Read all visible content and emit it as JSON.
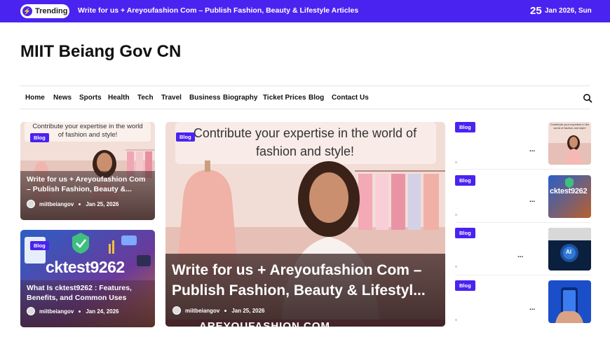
{
  "topbar": {
    "trending_label": "Trending",
    "trending_text": "Write for us + Areyoufashion Com – Publish Fashion, Beauty & Lifestyle Articles",
    "date_day": "25",
    "date_rest": "Jan 2026, Sun",
    "accent": "#4a23f0"
  },
  "site": {
    "title": "MIIT Beiang Gov CN"
  },
  "nav": {
    "items": [
      "Home",
      "News",
      "Sports",
      "Health",
      "Tech",
      "Travel",
      "Business",
      "Biography",
      "Ticket Prices",
      "Blog",
      "Contact Us"
    ]
  },
  "cards": {
    "left1": {
      "banner": "Contribute your expertise in the world of fashion and style!",
      "badge": "Blog",
      "title": "Write for us + Areyoufashion Com – Publish Fashion, Beauty &...",
      "author": "miitbeiangov",
      "date": "Jan 25, 2026"
    },
    "left2": {
      "badge": "Blog",
      "image_text": "cktest9262",
      "title": "What Is cktest9262 : Features, Benefits, and Common Uses",
      "author": "miitbeiangov",
      "date": "Jan 24, 2026"
    },
    "main": {
      "banner": "Contribute your expertise in the world of fashion and style!",
      "badge": "Blog",
      "title": "Write for us + Areyoufashion Com – Publish Fashion, Beauty & Lifestyl...",
      "author": "miitbeiangov",
      "date": "Jan 25, 2026",
      "footer_text": "AREYOUFASHION.COM"
    }
  },
  "sidebar": {
    "items": [
      {
        "badge": "Blog",
        "ellipsis": "...",
        "thumb_text": "Contribute your expertise in the world of fashion and style!"
      },
      {
        "badge": "Blog",
        "ellipsis": "...",
        "thumb_text": "cktest9262"
      },
      {
        "badge": "Blog",
        "ellipsis": "...",
        "thumb_text": "AI"
      },
      {
        "badge": "Blog",
        "ellipsis": "...",
        "thumb_text": ""
      }
    ]
  }
}
